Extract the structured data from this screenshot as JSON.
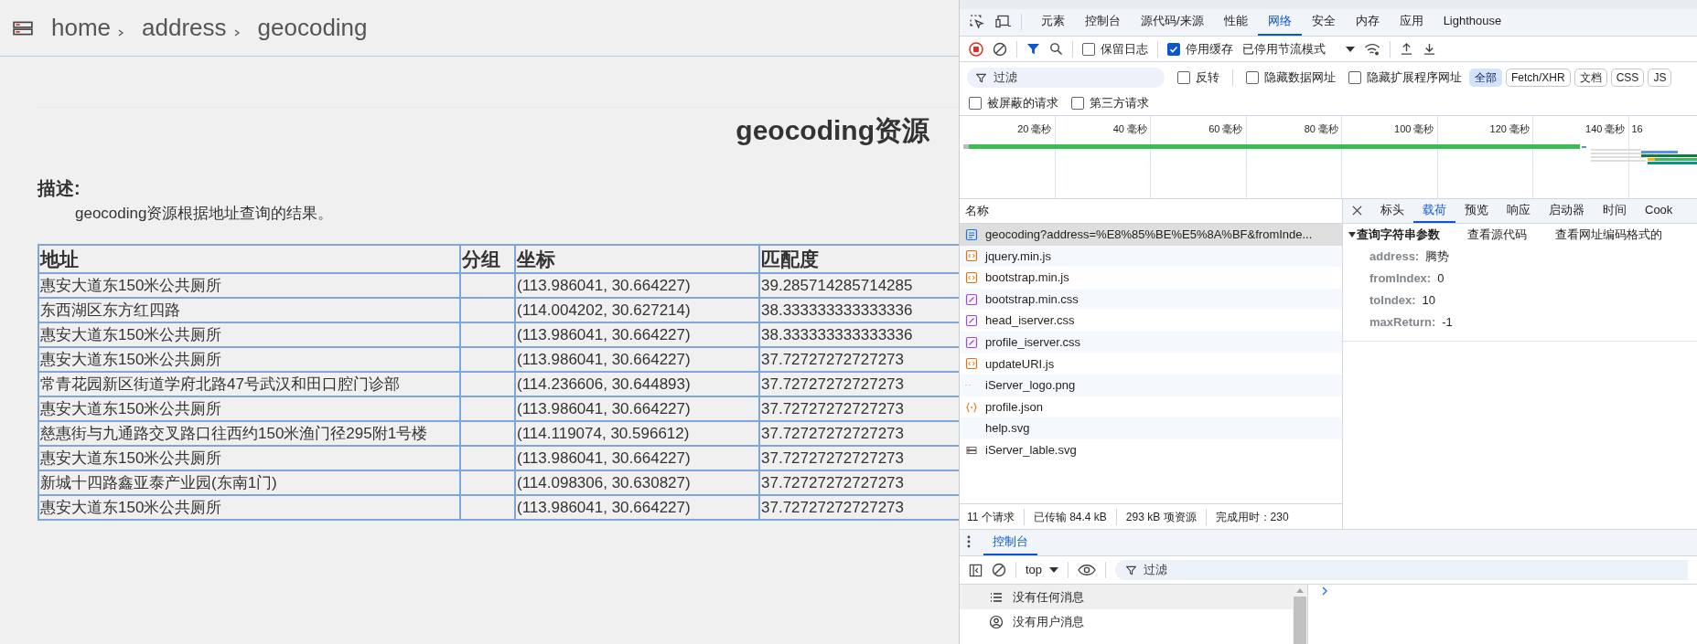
{
  "breadcrumb": [
    "home",
    "address",
    "geocoding"
  ],
  "page": {
    "title": "geocoding资源",
    "description_label": "描述:",
    "description": "geocoding资源根据地址查询的结果。"
  },
  "table": {
    "columns": [
      "地址",
      "分组",
      "坐标",
      "匹配度"
    ],
    "rows": [
      [
        "惠安大道东150米公共厕所",
        "",
        "(113.986041, 30.664227)",
        "39.285714285714285"
      ],
      [
        "东西湖区东方红四路",
        "",
        "(114.004202, 30.627214)",
        "38.333333333333336"
      ],
      [
        "惠安大道东150米公共厕所",
        "",
        "(113.986041, 30.664227)",
        "38.333333333333336"
      ],
      [
        "惠安大道东150米公共厕所",
        "",
        "(113.986041, 30.664227)",
        "37.72727272727273"
      ],
      [
        "常青花园新区街道学府北路47号武汉和田口腔门诊部",
        "",
        "(114.236606, 30.644893)",
        "37.72727272727273"
      ],
      [
        "惠安大道东150米公共厕所",
        "",
        "(113.986041, 30.664227)",
        "37.72727272727273"
      ],
      [
        "慈惠街与九通路交叉路口往西约150米渔门径295附1号楼",
        "",
        "(114.119074, 30.596612)",
        "37.72727272727273"
      ],
      [
        "惠安大道东150米公共厕所",
        "",
        "(113.986041, 30.664227)",
        "37.72727272727273"
      ],
      [
        "新城十四路鑫亚泰产业园(东南1门)",
        "",
        "(114.098306, 30.630827)",
        "37.72727272727273"
      ],
      [
        "惠安大道东150米公共厕所",
        "",
        "(113.986041, 30.664227)",
        "37.72727272727273"
      ]
    ]
  },
  "devtools": {
    "tabs": [
      {
        "label": "元素",
        "selected": false
      },
      {
        "label": "控制台",
        "selected": false
      },
      {
        "label": "源代码/来源",
        "selected": false
      },
      {
        "label": "性能",
        "selected": false
      },
      {
        "label": "网络",
        "selected": true
      },
      {
        "label": "安全",
        "selected": false
      },
      {
        "label": "内存",
        "selected": false
      },
      {
        "label": "应用",
        "selected": false
      },
      {
        "label": "Lighthouse",
        "selected": false
      }
    ],
    "toolbar_checks": [
      {
        "label": "保留日志",
        "checked": false
      },
      {
        "label": "停用缓存",
        "checked": true
      }
    ],
    "throttle": "已停用节流模式",
    "filter_placeholder": "过滤",
    "filter_checks": [
      {
        "label": "反转",
        "checked": false
      },
      {
        "label": "隐藏数据网址",
        "checked": false
      },
      {
        "label": "隐藏扩展程序网址",
        "checked": false
      }
    ],
    "type_chips": [
      {
        "label": "全部",
        "selected": true
      },
      {
        "label": "Fetch/XHR",
        "selected": false
      },
      {
        "label": "文档",
        "selected": false
      },
      {
        "label": "CSS",
        "selected": false
      },
      {
        "label": "JS",
        "selected": false
      }
    ],
    "extra_checks": [
      {
        "label": "被屏蔽的请求",
        "checked": false
      },
      {
        "label": "第三方请求",
        "checked": false
      }
    ],
    "timeline_ticks": [
      "20 毫秒",
      "40 毫秒",
      "60 毫秒",
      "80 毫秒",
      "100 毫秒",
      "120 毫秒",
      "140 毫秒",
      "16"
    ],
    "name_header": "名称",
    "requests": [
      {
        "name": "geocoding?address=%E8%85%BE%E5%8A%BF&fromInde...",
        "kind": "doc",
        "selected": true
      },
      {
        "name": "jquery.min.js",
        "kind": "script",
        "selected": false
      },
      {
        "name": "bootstrap.min.js",
        "kind": "script",
        "selected": false
      },
      {
        "name": "bootstrap.min.css",
        "kind": "css",
        "selected": false
      },
      {
        "name": "head_iserver.css",
        "kind": "css",
        "selected": false
      },
      {
        "name": "profile_iserver.css",
        "kind": "css",
        "selected": false
      },
      {
        "name": "updateURI.js",
        "kind": "script",
        "selected": false
      },
      {
        "name": "iServer_logo.png",
        "kind": "image",
        "selected": false
      },
      {
        "name": "profile.json",
        "kind": "json",
        "selected": false
      },
      {
        "name": "help.svg",
        "kind": "blank",
        "selected": false
      },
      {
        "name": "iServer_lable.svg",
        "kind": "svg",
        "selected": false
      }
    ],
    "detail_tabs": [
      {
        "label": "标头",
        "selected": false
      },
      {
        "label": "载荷",
        "selected": true
      },
      {
        "label": "预览",
        "selected": false
      },
      {
        "label": "响应",
        "selected": false
      },
      {
        "label": "启动器",
        "selected": false
      },
      {
        "label": "时间",
        "selected": false
      },
      {
        "label": "Cook",
        "selected": false
      }
    ],
    "payload": {
      "section": "查询字符串参数",
      "actions": [
        "查看源代码",
        "查看网址编码格式的"
      ],
      "params": [
        {
          "key": "address:",
          "value": "腾势"
        },
        {
          "key": "fromIndex:",
          "value": "0"
        },
        {
          "key": "toIndex:",
          "value": "10"
        },
        {
          "key": "maxReturn:",
          "value": "-1"
        }
      ]
    },
    "status": [
      "11 个请求",
      "已传输 84.4 kB",
      "293 kB 项资源",
      "完成用时：230"
    ],
    "drawer": {
      "tabs": [
        {
          "label": "控制台",
          "selected": true
        }
      ],
      "context": "top",
      "filter_placeholder": "过滤",
      "sidebar": [
        {
          "label": "没有任何消息",
          "kind": "list",
          "selected": true
        },
        {
          "label": "没有用户消息",
          "kind": "user",
          "selected": false
        }
      ]
    }
  }
}
